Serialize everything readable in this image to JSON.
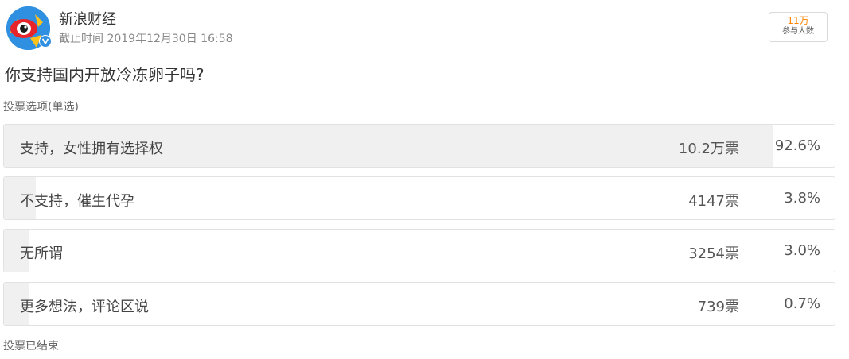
{
  "header": {
    "author": "新浪财经",
    "deadline": "截止时间 2019年12月30日 16:58",
    "participants_count": "11万",
    "participants_label": "参与人数"
  },
  "poll": {
    "question": "你支持国内开放冷冻卵子吗?",
    "type_label": "投票选项(单选)",
    "options": [
      {
        "text": "支持，女性拥有选择权",
        "votes": "10.2万票",
        "percent": "92.6%",
        "share": 0.926
      },
      {
        "text": "不支持，催生代孕",
        "votes": "4147票",
        "percent": "3.8%",
        "share": 0.038
      },
      {
        "text": "无所谓",
        "votes": "3254票",
        "percent": "3.0%",
        "share": 0.03
      },
      {
        "text": "更多想法，评论区说",
        "votes": "739票",
        "percent": "0.7%",
        "share": 0.007
      }
    ],
    "status": "投票已结束"
  },
  "icons": {
    "avatar": "sina-eye-logo-icon",
    "verified": "verified-badge-icon"
  },
  "colors": {
    "accent": "#ff8200",
    "bar_fill": "#f0f0f0",
    "verified": "#2f8fe0"
  }
}
